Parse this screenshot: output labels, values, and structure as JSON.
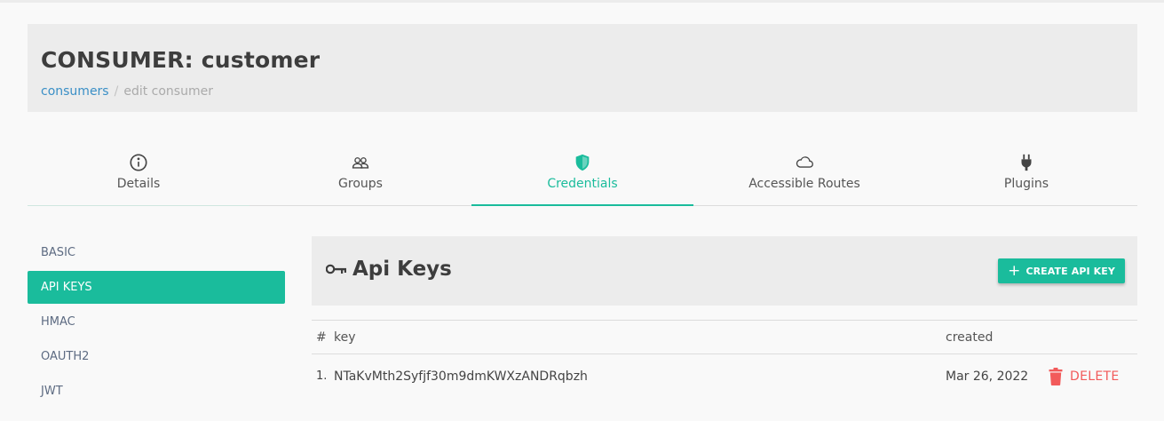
{
  "header": {
    "title": "CONSUMER: customer",
    "breadcrumb": {
      "link": "consumers",
      "separator": "/",
      "current": "edit consumer"
    }
  },
  "tabs": [
    {
      "label": "Details",
      "icon": "info-icon"
    },
    {
      "label": "Groups",
      "icon": "users-icon"
    },
    {
      "label": "Credentials",
      "icon": "shield-icon",
      "active": true
    },
    {
      "label": "Accessible Routes",
      "icon": "cloud-icon"
    },
    {
      "label": "Plugins",
      "icon": "plug-icon"
    }
  ],
  "sidebar": {
    "items": [
      {
        "label": "BASIC"
      },
      {
        "label": "API KEYS",
        "active": true
      },
      {
        "label": "HMAC"
      },
      {
        "label": "OAUTH2"
      },
      {
        "label": "JWT"
      }
    ]
  },
  "panel": {
    "title": "Api Keys",
    "title_icon": "key-icon",
    "create_button": {
      "plus": "+",
      "label": "CREATE API KEY"
    }
  },
  "table": {
    "columns": {
      "num": "#",
      "key": "key",
      "created": "created"
    },
    "rows": [
      {
        "num": "1.",
        "key": "NTaKvMth2Syfjf30m9dmKWXzANDRqbzh",
        "created": "Mar 26, 2022",
        "action": "DELETE"
      }
    ]
  },
  "colors": {
    "accent": "#1abc9c",
    "danger": "#f25a5a",
    "link": "#3a8fc6"
  }
}
